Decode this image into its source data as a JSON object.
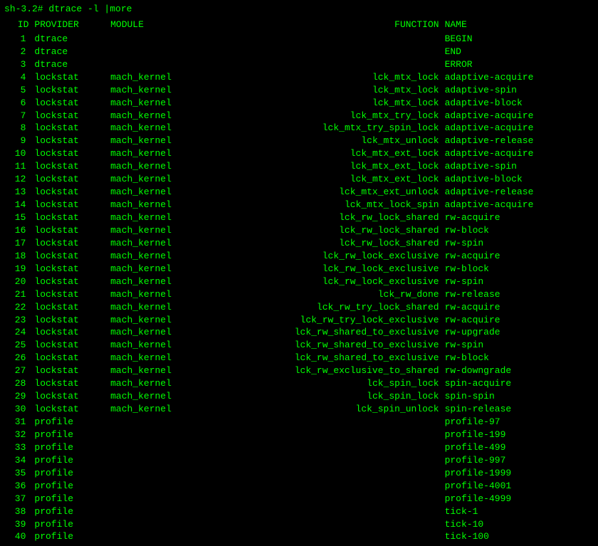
{
  "prompt": "sh-3.2# dtrace -l |more",
  "headers": {
    "id": "ID",
    "provider": "PROVIDER",
    "module": "MODULE",
    "function": "FUNCTION",
    "name": "NAME"
  },
  "rows": [
    {
      "id": "1",
      "provider": "dtrace",
      "module": "",
      "function": "",
      "name": "BEGIN"
    },
    {
      "id": "2",
      "provider": "dtrace",
      "module": "",
      "function": "",
      "name": "END"
    },
    {
      "id": "3",
      "provider": "dtrace",
      "module": "",
      "function": "",
      "name": "ERROR"
    },
    {
      "id": "4",
      "provider": "lockstat",
      "module": "mach_kernel",
      "function": "lck_mtx_lock",
      "name": "adaptive-acquire"
    },
    {
      "id": "5",
      "provider": "lockstat",
      "module": "mach_kernel",
      "function": "lck_mtx_lock",
      "name": "adaptive-spin"
    },
    {
      "id": "6",
      "provider": "lockstat",
      "module": "mach_kernel",
      "function": "lck_mtx_lock",
      "name": "adaptive-block"
    },
    {
      "id": "7",
      "provider": "lockstat",
      "module": "mach_kernel",
      "function": "lck_mtx_try_lock",
      "name": "adaptive-acquire"
    },
    {
      "id": "8",
      "provider": "lockstat",
      "module": "mach_kernel",
      "function": "lck_mtx_try_spin_lock",
      "name": "adaptive-acquire"
    },
    {
      "id": "9",
      "provider": "lockstat",
      "module": "mach_kernel",
      "function": "lck_mtx_unlock",
      "name": "adaptive-release"
    },
    {
      "id": "10",
      "provider": "lockstat",
      "module": "mach_kernel",
      "function": "lck_mtx_ext_lock",
      "name": "adaptive-acquire"
    },
    {
      "id": "11",
      "provider": "lockstat",
      "module": "mach_kernel",
      "function": "lck_mtx_ext_lock",
      "name": "adaptive-spin"
    },
    {
      "id": "12",
      "provider": "lockstat",
      "module": "mach_kernel",
      "function": "lck_mtx_ext_lock",
      "name": "adaptive-block"
    },
    {
      "id": "13",
      "provider": "lockstat",
      "module": "mach_kernel",
      "function": "lck_mtx_ext_unlock",
      "name": "adaptive-release"
    },
    {
      "id": "14",
      "provider": "lockstat",
      "module": "mach_kernel",
      "function": "lck_mtx_lock_spin",
      "name": "adaptive-acquire"
    },
    {
      "id": "15",
      "provider": "lockstat",
      "module": "mach_kernel",
      "function": "lck_rw_lock_shared",
      "name": "rw-acquire"
    },
    {
      "id": "16",
      "provider": "lockstat",
      "module": "mach_kernel",
      "function": "lck_rw_lock_shared",
      "name": "rw-block"
    },
    {
      "id": "17",
      "provider": "lockstat",
      "module": "mach_kernel",
      "function": "lck_rw_lock_shared",
      "name": "rw-spin"
    },
    {
      "id": "18",
      "provider": "lockstat",
      "module": "mach_kernel",
      "function": "lck_rw_lock_exclusive",
      "name": "rw-acquire"
    },
    {
      "id": "19",
      "provider": "lockstat",
      "module": "mach_kernel",
      "function": "lck_rw_lock_exclusive",
      "name": "rw-block"
    },
    {
      "id": "20",
      "provider": "lockstat",
      "module": "mach_kernel",
      "function": "lck_rw_lock_exclusive",
      "name": "rw-spin"
    },
    {
      "id": "21",
      "provider": "lockstat",
      "module": "mach_kernel",
      "function": "lck_rw_done",
      "name": "rw-release"
    },
    {
      "id": "22",
      "provider": "lockstat",
      "module": "mach_kernel",
      "function": "lck_rw_try_lock_shared",
      "name": "rw-acquire"
    },
    {
      "id": "23",
      "provider": "lockstat",
      "module": "mach_kernel",
      "function": "lck_rw_try_lock_exclusive",
      "name": "rw-acquire"
    },
    {
      "id": "24",
      "provider": "lockstat",
      "module": "mach_kernel",
      "function": "lck_rw_shared_to_exclusive",
      "name": "rw-upgrade"
    },
    {
      "id": "25",
      "provider": "lockstat",
      "module": "mach_kernel",
      "function": "lck_rw_shared_to_exclusive",
      "name": "rw-spin"
    },
    {
      "id": "26",
      "provider": "lockstat",
      "module": "mach_kernel",
      "function": "lck_rw_shared_to_exclusive",
      "name": "rw-block"
    },
    {
      "id": "27",
      "provider": "lockstat",
      "module": "mach_kernel",
      "function": "lck_rw_exclusive_to_shared",
      "name": "rw-downgrade"
    },
    {
      "id": "28",
      "provider": "lockstat",
      "module": "mach_kernel",
      "function": "lck_spin_lock",
      "name": "spin-acquire"
    },
    {
      "id": "29",
      "provider": "lockstat",
      "module": "mach_kernel",
      "function": "lck_spin_lock",
      "name": "spin-spin"
    },
    {
      "id": "30",
      "provider": "lockstat",
      "module": "mach_kernel",
      "function": "lck_spin_unlock",
      "name": "spin-release"
    },
    {
      "id": "31",
      "provider": "profile",
      "module": "",
      "function": "",
      "name": "profile-97"
    },
    {
      "id": "32",
      "provider": "profile",
      "module": "",
      "function": "",
      "name": "profile-199"
    },
    {
      "id": "33",
      "provider": "profile",
      "module": "",
      "function": "",
      "name": "profile-499"
    },
    {
      "id": "34",
      "provider": "profile",
      "module": "",
      "function": "",
      "name": "profile-997"
    },
    {
      "id": "35",
      "provider": "profile",
      "module": "",
      "function": "",
      "name": "profile-1999"
    },
    {
      "id": "36",
      "provider": "profile",
      "module": "",
      "function": "",
      "name": "profile-4001"
    },
    {
      "id": "37",
      "provider": "profile",
      "module": "",
      "function": "",
      "name": "profile-4999"
    },
    {
      "id": "38",
      "provider": "profile",
      "module": "",
      "function": "",
      "name": "tick-1"
    },
    {
      "id": "39",
      "provider": "profile",
      "module": "",
      "function": "",
      "name": "tick-10"
    },
    {
      "id": "40",
      "provider": "profile",
      "module": "",
      "function": "",
      "name": "tick-100"
    }
  ]
}
